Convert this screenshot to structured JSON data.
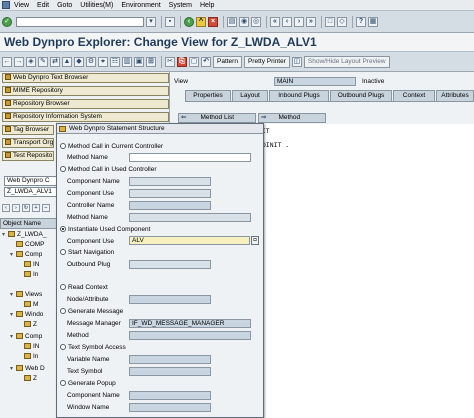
{
  "menu": {
    "items": [
      "View",
      "Edit",
      "Goto",
      "Utilities(M)",
      "Environment",
      "System",
      "Help"
    ]
  },
  "title": "Web Dynpro Explorer: Change View for Z_LWDA_ALV1",
  "app_toolbar": {
    "pattern_label": "Pattern",
    "pretty_printer_label": "Pretty Printer",
    "layout_preview_label": "Show/Hide Layout Preview"
  },
  "navigator": {
    "buttons": [
      {
        "label": "Web Dynpro Text Browser"
      },
      {
        "label": "MIME Repository"
      },
      {
        "label": "Repository Browser"
      },
      {
        "label": "Repository Information System"
      },
      {
        "label": "Tag Browser"
      },
      {
        "label": "Transport Org"
      },
      {
        "label": "Test Reposito"
      }
    ],
    "object_type_value": "Web Dynpro C",
    "object_name_value": "Z_LWDA_ALV1",
    "object_name_header": "Object Name",
    "tree": [
      {
        "label": "Z_LWDA_",
        "level": 0
      },
      {
        "label": "COMP",
        "level": 1
      },
      {
        "label": "Comp",
        "level": 1
      },
      {
        "label": "IN",
        "level": 2
      },
      {
        "label": "In",
        "level": 2
      },
      {
        "label": "Views",
        "level": 1
      },
      {
        "label": "M",
        "level": 2
      },
      {
        "label": "Windo",
        "level": 1
      },
      {
        "label": "Z",
        "level": 2
      },
      {
        "label": "Comp",
        "level": 1
      },
      {
        "label": "IN",
        "level": 2
      },
      {
        "label": "In",
        "level": 2
      },
      {
        "label": "Web D",
        "level": 1
      },
      {
        "label": "Z",
        "level": 2
      }
    ]
  },
  "view": {
    "view_label": "View",
    "view_value": "MAIN",
    "status": "Inactive"
  },
  "tabs": [
    "Properties",
    "Layout",
    "Inbound Plugs",
    "Outbound Plugs",
    "Context",
    "Attributes"
  ],
  "method_list_label": "Method List",
  "method_label": "Method",
  "method_value": "KIT",
  "code_lines": [
    "DOINIT ."
  ],
  "dialog": {
    "title": "Web Dynpro Statement Structure",
    "opt_method_call_current": "Method Call in Current Controller",
    "method_name_label": "Method Name",
    "opt_method_call_used": "Method Call in Used Controller",
    "component_name_label": "Component Name",
    "component_use_label": "Component Use",
    "controller_name_label": "Controller Name",
    "method_name2_label": "Method Name",
    "opt_instantiate": "Instantiate Used Component",
    "component_use2_label": "Component Use",
    "component_use2_value": "ALV",
    "opt_start_nav": "Start Navigation",
    "outbound_plug_label": "Outbound Plug",
    "opt_read_context": "Read Context",
    "node_attr_label": "Node/Attribute",
    "opt_generate_message": "Generate Message",
    "message_manager_label": "Message Manager",
    "message_manager_value": "IF_WD_MESSAGE_MANAGER",
    "method_label": "Method",
    "opt_text_symbol": "Text Symbol Access",
    "variable_name_label": "Variable Name",
    "text_symbol_label": "Text Symbol",
    "opt_generate_popup": "Generate Popup",
    "component_name2_label": "Component Name",
    "window_name_label": "Window Name",
    "selected_option": "Instantiate Used Component"
  },
  "colors": {
    "title": "#1f3b5a",
    "nav_button_bg": "#eeead2",
    "input_bg": "#c9d6e2",
    "selected_field_bg": "#f6f0c0"
  }
}
